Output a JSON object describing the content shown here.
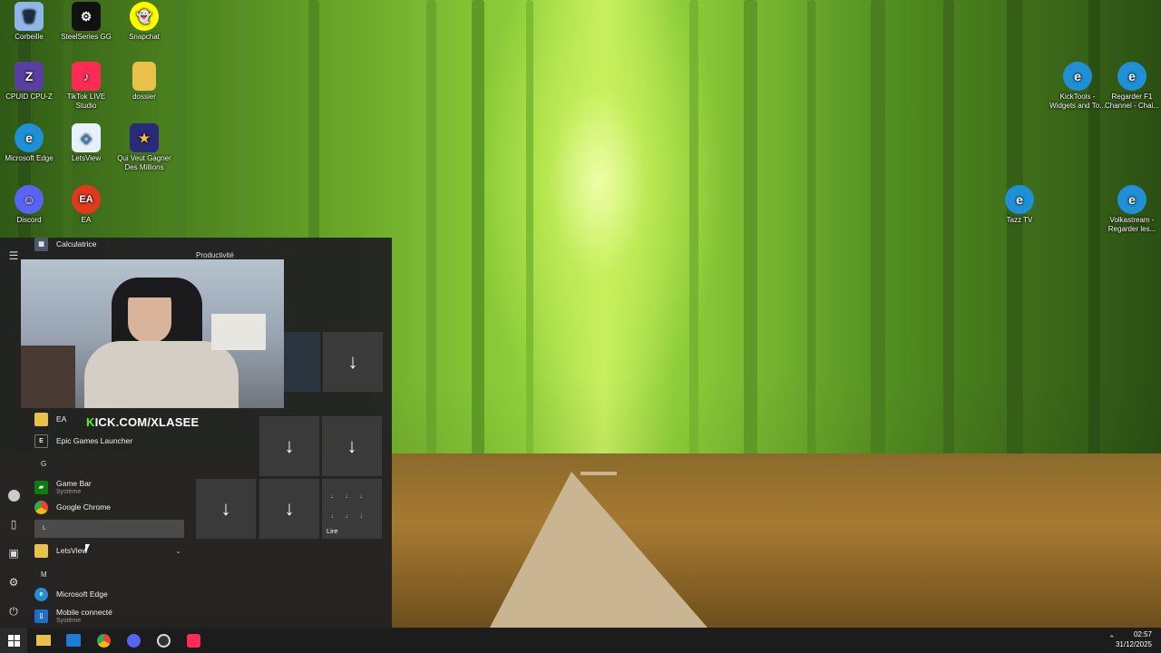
{
  "desktop": {
    "icons_left": [
      {
        "name": "recycle-bin",
        "label": "Corbeille",
        "color": "#5b8fd6",
        "glyph": "🗑"
      },
      {
        "name": "steelseries-gg",
        "label": "SteelSeries GG",
        "color": "#222222",
        "glyph": "⚙"
      },
      {
        "name": "snapchat",
        "label": "Snapchat",
        "color": "#fffc00",
        "glyph": "👻"
      },
      {
        "name": "cpuid",
        "label": "CPUID CPU-Z",
        "color": "#5a3fa0",
        "glyph": "Z"
      },
      {
        "name": "tiktok-live",
        "label": "TikTok LIVE Studio",
        "color": "#fe2c55",
        "glyph": "♪"
      },
      {
        "name": "dossier",
        "label": "dossier",
        "color": "#e8c04a",
        "glyph": ""
      },
      {
        "name": "microsoft-edge",
        "label": "Microsoft Edge",
        "color": "#1f8fd6",
        "glyph": "e"
      },
      {
        "name": "letsview",
        "label": "LetsView",
        "color": "#e6f1fb",
        "glyph": "◇"
      },
      {
        "name": "qui-veut-gagner",
        "label": "Qui Veut Gagner Des Millions",
        "color": "#2b2a7a",
        "glyph": "★"
      },
      {
        "name": "discord",
        "label": "Discord",
        "color": "#5865f2",
        "glyph": "☺"
      },
      {
        "name": "ea",
        "label": "EA",
        "color": "#e2381e",
        "glyph": "EA"
      }
    ],
    "icons_right": [
      {
        "name": "kicktools",
        "label": "KickTools - Widgets and To...",
        "color": "#1f8fd6",
        "glyph": "e"
      },
      {
        "name": "regarder-f1",
        "label": "Regarder F1 Channel - Chai...",
        "color": "#1f8fd6",
        "glyph": "e"
      },
      {
        "name": "tazz-tv",
        "label": "Tazz TV",
        "color": "#1f8fd6",
        "glyph": "e"
      },
      {
        "name": "volkastream",
        "label": "Volkastream - Regarder les...",
        "color": "#1f8fd6",
        "glyph": "e"
      }
    ]
  },
  "start_menu": {
    "group_title": "Productivité",
    "overlay_text_k": "K",
    "overlay_text_rest": "ICK.COM/XLASEE",
    "apps": {
      "calculatrice": "Calculatrice",
      "ea": "EA",
      "epic": "Epic Games Launcher",
      "letter_g": "G",
      "game_bar": "Game Bar",
      "game_bar_sub": "Système",
      "chrome": "Google Chrome",
      "letter_l": "L",
      "letsview": "LetsView",
      "letter_m": "M",
      "edge": "Microsoft Edge",
      "mobile": "Mobile connecté",
      "mobile_sub": "Système"
    },
    "tile_lire": "Lire",
    "download_glyph": "↓"
  },
  "taskbar": {
    "time": "02:57",
    "date": "31/12/2025"
  },
  "colors": {
    "start_bg": "#222222",
    "tile_bg": "#3a3a3a",
    "kick_green": "#53fc18",
    "taskbar": "#1c1c1c"
  }
}
